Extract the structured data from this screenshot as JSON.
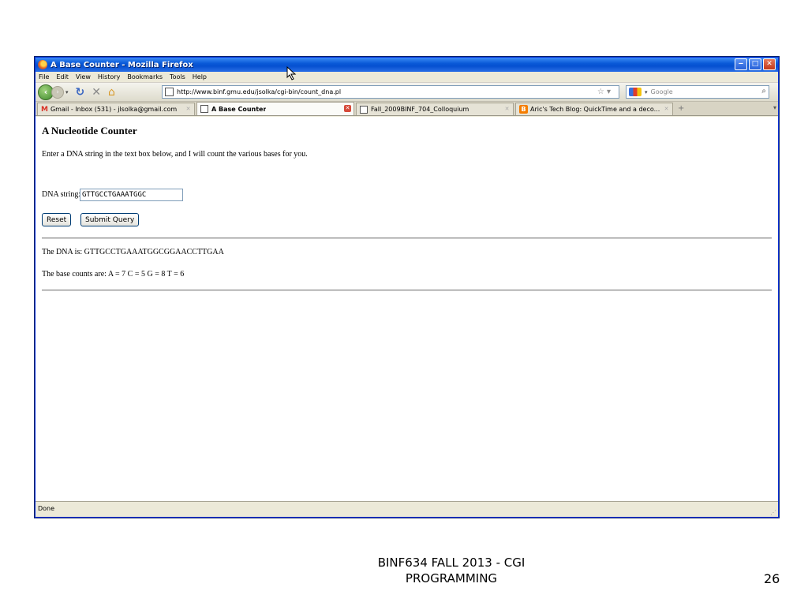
{
  "window": {
    "title": "A Base Counter - Mozilla Firefox",
    "min_glyph": "‒",
    "max_glyph": "□",
    "close_glyph": "✕"
  },
  "menu": [
    "File",
    "Edit",
    "View",
    "History",
    "Bookmarks",
    "Tools",
    "Help"
  ],
  "nav": {
    "url": "http://www.binf.gmu.edu/jsolka/cgi-bin/count_dna.pl",
    "search_placeholder": "Google"
  },
  "tabs": [
    {
      "label": "Gmail - Inbox (531) - jlsolka@gmail.com",
      "active": false
    },
    {
      "label": "A Base Counter",
      "active": true
    },
    {
      "label": "Fall_2009BINF_704_Colloquium",
      "active": false
    },
    {
      "label": "Aric's Tech Blog: QuickTime and a deco...",
      "active": false
    }
  ],
  "page": {
    "heading": "A Nucleotide Counter",
    "intro": "Enter a DNA string in the text box below, and I will count the various bases for you.",
    "dna_label": "DNA string:",
    "dna_value": "GTTGCCTGAAATGGC",
    "reset_label": "Reset",
    "submit_label": "Submit Query",
    "result_dna": "The DNA is: GTTGCCTGAAATGGCGGAACCTTGAA",
    "result_counts": "The base counts are: A = 7 C = 5 G = 8 T = 6"
  },
  "status": {
    "text": "Done"
  },
  "slide": {
    "footer_line1": "BINF634 FALL 2013 - CGI",
    "footer_line2": "PROGRAMMING",
    "number": "26"
  }
}
